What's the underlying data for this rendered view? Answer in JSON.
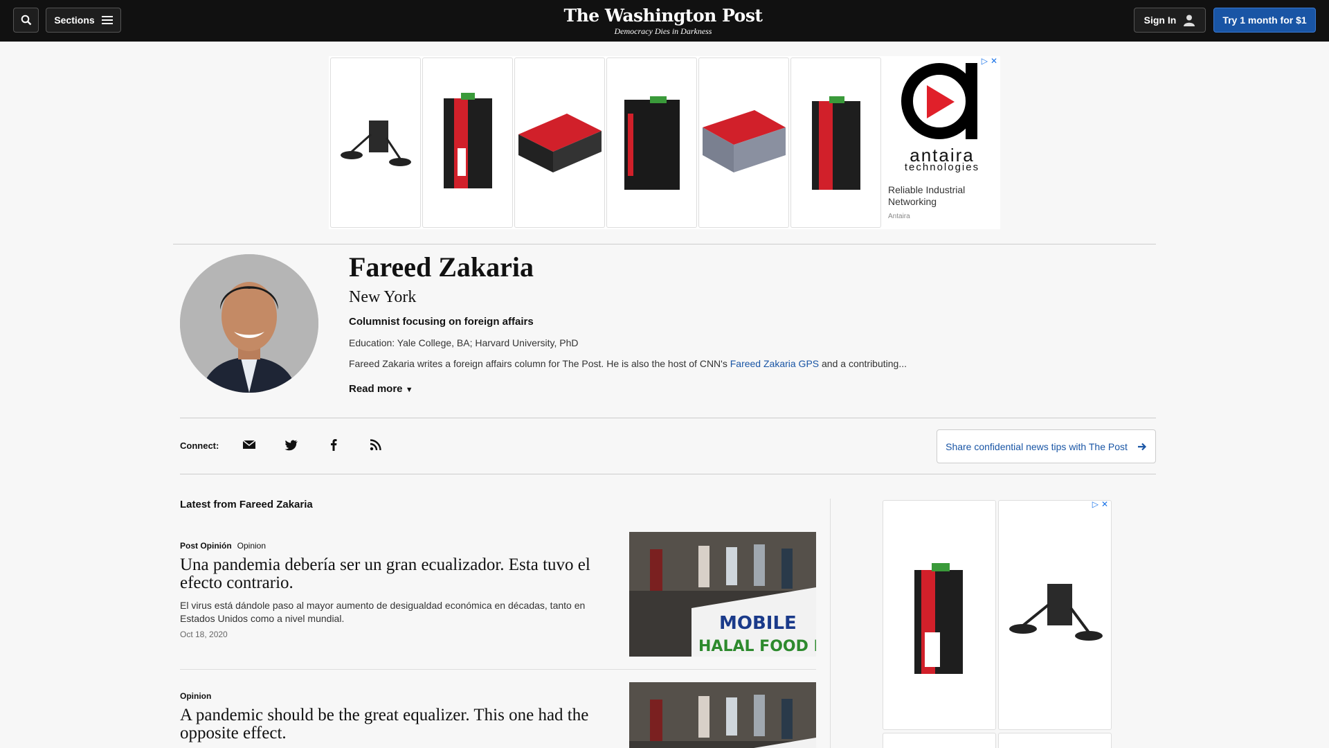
{
  "header": {
    "sections_label": "Sections",
    "brand": "The Washington Post",
    "tagline": "Democracy Dies in Darkness",
    "signin_label": "Sign In",
    "cta_label": "Try 1 month for $1",
    "icons": [
      "search-icon",
      "hamburger-menu-icon",
      "user-icon"
    ]
  },
  "ad_top": {
    "brand_name": "antaira",
    "brand_sub": "technologies",
    "headline": "Reliable Industrial Networking",
    "advertiser": "Antaira"
  },
  "profile": {
    "name": "Fareed Zakaria",
    "city": "New York",
    "role": "Columnist focusing on foreign affairs",
    "education": "Education: Yale College, BA; Harvard University, PhD",
    "bio_before": "Fareed Zakaria writes a foreign affairs column for The Post. He is also the host of CNN's ",
    "bio_link": "Fareed Zakaria GPS",
    "bio_after": " and a contributing...",
    "read_more": "Read more"
  },
  "connect": {
    "label": "Connect:",
    "icons": [
      "email-icon",
      "twitter-icon",
      "facebook-icon",
      "rss-icon"
    ],
    "tips_label": "Share confidential news tips with The Post"
  },
  "latest": {
    "heading": "Latest from Fareed Zakaria",
    "articles": [
      {
        "kicker_brand": "Post Opinión",
        "kicker_section": "Opinion",
        "title": "Una pandemia debería ser un gran ecualizador. Esta tuvo el efecto contrario.",
        "blurb": "El virus está dándole paso al mayor aumento de desigualdad económica en décadas, tanto en Estados Unidos como a nivel mundial.",
        "date": "Oct 18, 2020",
        "banner_text": "MOBILE HALAL FOOD PANTRY"
      },
      {
        "kicker_section": "Opinion",
        "title": "A pandemic should be the great equalizer. This one had the opposite effect."
      }
    ]
  },
  "colors": {
    "topbar": "#111111",
    "accent": "#1955a5",
    "background": "#f7f7f7"
  }
}
